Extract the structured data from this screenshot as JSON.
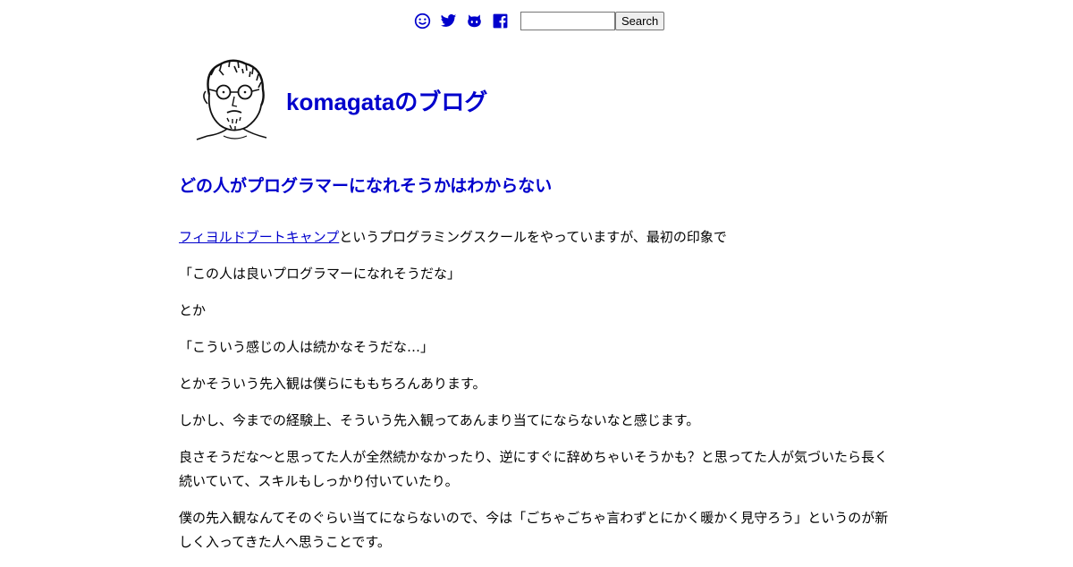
{
  "nav": {
    "icons": [
      "smiley-icon",
      "twitter-icon",
      "github-icon",
      "facebook-icon"
    ],
    "search_placeholder": "",
    "search_button_label": "Search"
  },
  "header": {
    "blog_title": "komagataのブログ"
  },
  "post": {
    "title": "どの人がプログラマーになれそうかはわからない",
    "link_text": "フィヨルドブートキャンプ",
    "p1_rest": "というプログラミングスクールをやっていますが、最初の印象で",
    "p2": "「この人は良いプログラマーになれそうだな」",
    "p3": "とか",
    "p4": "「こういう感じの人は続かなそうだな…」",
    "p5": "とかそういう先入観は僕らにももちろんあります。",
    "p6": "しかし、今までの経験上、そういう先入観ってあんまり当てにならないなと感じます。",
    "p7": "良さそうだな〜と思ってた人が全然続かなかったり、逆にすぐに辞めちゃいそうかも？と思ってた人が気づいたら長く続いていて、スキルもしっかり付いていたり。",
    "p8": "僕の先入観なんてそのぐらい当てにならないので、今は「ごちゃごちゃ言わずとにかく暖かく見守ろう」というのが新しく入ってきた人へ思うことです。"
  },
  "colors": {
    "link": "#0000cc",
    "text": "#000000",
    "background": "#ffffff"
  }
}
